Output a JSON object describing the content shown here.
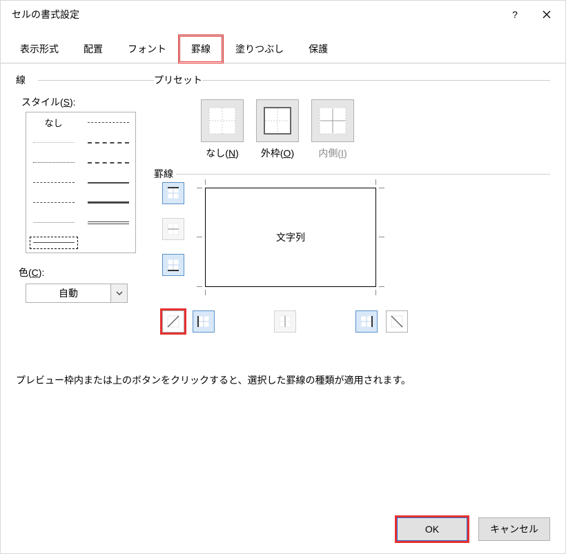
{
  "title": "セルの書式設定",
  "titlebar": {
    "help": "?",
    "close": "×"
  },
  "tabs": {
    "display": "表示形式",
    "alignment": "配置",
    "font": "フォント",
    "border": "罫線",
    "fill": "塗りつぶし",
    "protection": "保護"
  },
  "line_group": {
    "title": "線",
    "style_label_prefix": "スタイル(",
    "style_label_key": "S",
    "style_label_suffix": "):",
    "none_label": "なし",
    "color_label_prefix": "色(",
    "color_label_key": "C",
    "color_label_suffix": "):",
    "color_value": "自動"
  },
  "preset": {
    "title": "プリセット",
    "none_prefix": "なし(",
    "none_key": "N",
    "none_suffix": ")",
    "outline_prefix": "外枠(",
    "outline_key": "O",
    "outline_suffix": ")",
    "inside_prefix": "内側(",
    "inside_key": "I",
    "inside_suffix": ")"
  },
  "border_section": {
    "title": "罫線",
    "preview_text": "文字列"
  },
  "hint_text": "プレビュー枠内または上のボタンをクリックすると、選択した罫線の種類が適用されます。",
  "buttons": {
    "ok": "OK",
    "cancel": "キャンセル"
  }
}
